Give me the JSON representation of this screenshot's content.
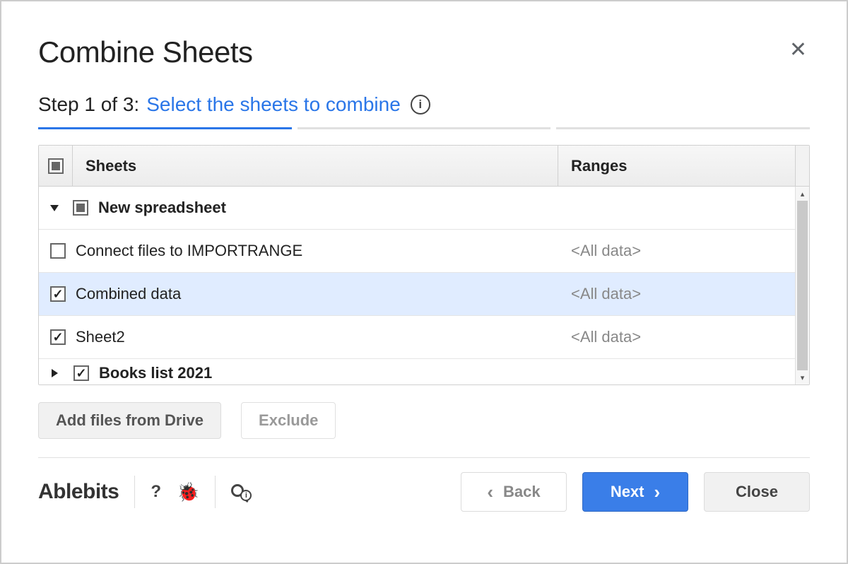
{
  "header": {
    "title": "Combine Sheets"
  },
  "step": {
    "prefix": "Step 1 of 3:",
    "subtitle": "Select the sheets to combine",
    "info_tooltip": "i"
  },
  "table": {
    "columns": {
      "sheets": "Sheets",
      "ranges": "Ranges"
    },
    "groups": [
      {
        "name": "New spreadsheet",
        "expanded": true,
        "check_state": "indeterminate",
        "rows": [
          {
            "name": "Connect files to IMPORTRANGE",
            "range": "<All data>",
            "checked": false,
            "selected": false
          },
          {
            "name": "Combined data",
            "range": "<All data>",
            "checked": true,
            "selected": true
          },
          {
            "name": "Sheet2",
            "range": "<All data>",
            "checked": true,
            "selected": false
          }
        ]
      },
      {
        "name": "Books list 2021",
        "expanded": false,
        "check_state": "checked",
        "rows": []
      }
    ]
  },
  "actions": {
    "add_files": "Add files from Drive",
    "exclude": "Exclude"
  },
  "footer": {
    "brand": "Ablebits",
    "back": "Back",
    "next": "Next",
    "close": "Close"
  }
}
